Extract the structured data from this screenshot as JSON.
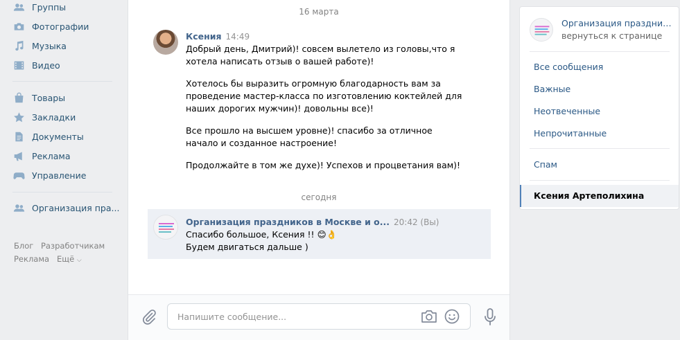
{
  "leftnav": {
    "items": [
      {
        "label": "Группы",
        "icon": "groups-icon"
      },
      {
        "label": "Фотографии",
        "icon": "camera-icon"
      },
      {
        "label": "Музыка",
        "icon": "music-icon"
      },
      {
        "label": "Видео",
        "icon": "video-icon"
      },
      {
        "label": "Товары",
        "icon": "bag-icon"
      },
      {
        "label": "Закладки",
        "icon": "star-icon"
      },
      {
        "label": "Документы",
        "icon": "document-icon"
      },
      {
        "label": "Реклама",
        "icon": "megaphone-icon"
      },
      {
        "label": "Управление",
        "icon": "gamepad-icon"
      },
      {
        "label": "Организация пра...",
        "icon": "groups-icon"
      }
    ],
    "footer": {
      "blog": "Блог",
      "developers": "Разработчикам",
      "ads": "Реклама",
      "more": "Ещё"
    }
  },
  "chat": {
    "date1": "16 марта",
    "message1": {
      "author": "Ксения",
      "time": "14:49",
      "paragraphs": [
        "Добрый день, Дмитрий)! совсем вылетело из головы,что я хотела написать отзыв о вашей работе)!",
        "Хотелось бы выразить огромную благодарность вам за проведение мастер-класса по изготовлению коктейлей для наших дорогих мужчин)! довольны все)!",
        "Все прошло на высшем уровне)! спасибо за отличное начало и созданное настроение!",
        "Продолжайте в том же духе)! Успехов и процветания вам)!"
      ]
    },
    "date2": "сегодня",
    "message2": {
      "author": "Организация праздников в Москве и о...",
      "time": "20:42 (Вы)",
      "line1": "Спасибо большое, Ксения !!",
      "emoji": "😊👌",
      "line2": "Будем двигаться дальше )"
    },
    "composer": {
      "placeholder": "Напишите сообщение..."
    }
  },
  "rightpanel": {
    "title": "Организация праздников в Москве и области",
    "subtitle": "вернуться к странице",
    "items": [
      "Все сообщения",
      "Важные",
      "Неотвеченные",
      "Непрочитанные",
      "Спам"
    ],
    "active": "Ксения Артеполихина"
  },
  "colors": {
    "accent": "#5181b8",
    "link": "#2a5885",
    "name": "#42648b",
    "background": "#edeef0"
  }
}
